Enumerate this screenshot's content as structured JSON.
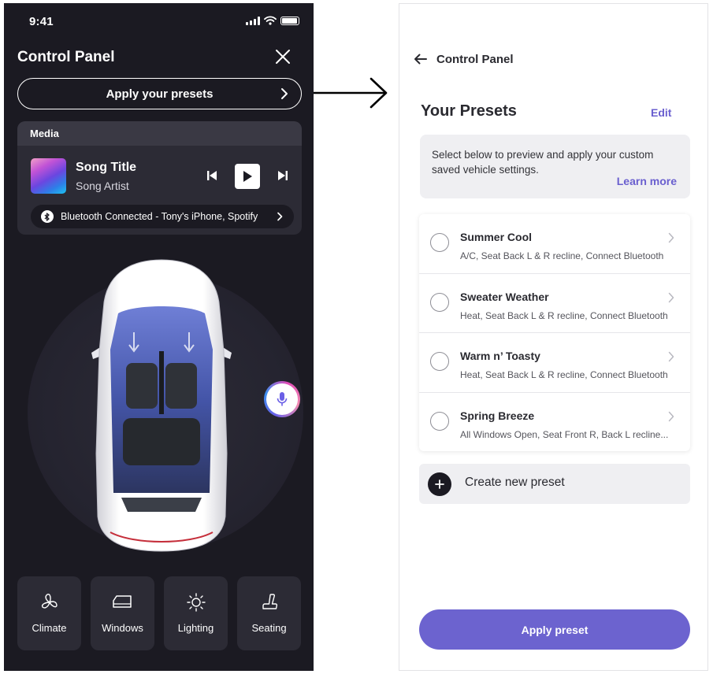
{
  "status_bar": {
    "time": "9:41"
  },
  "control_panel": {
    "title": "Control Panel",
    "presets_button_label": "Apply your presets",
    "media": {
      "section_label": "Media",
      "song_title": "Song Title",
      "song_artist": "Song Artist",
      "bluetooth_status": "Bluetooth Connected - Tony's iPhone, Spotify"
    },
    "tiles": [
      {
        "label": "Climate",
        "icon": "fan-icon"
      },
      {
        "label": "Windows",
        "icon": "window-icon"
      },
      {
        "label": "Lighting",
        "icon": "sun-icon"
      },
      {
        "label": "Seating",
        "icon": "seat-icon"
      }
    ]
  },
  "presets_screen": {
    "back_title": "Control Panel",
    "heading": "Your Presets",
    "edit_label": "Edit",
    "info_text": "Select below to preview and apply your custom saved vehicle settings.",
    "learn_more_label": "Learn more",
    "presets": [
      {
        "name": "Summer Cool",
        "description": "A/C, Seat Back L & R recline, Connect Bluetooth"
      },
      {
        "name": "Sweater Weather",
        "description": "Heat, Seat Back L & R recline, Connect Bluetooth"
      },
      {
        "name": "Warm n’ Toasty",
        "description": "Heat, Seat Back L & R recline, Connect Bluetooth"
      },
      {
        "name": "Spring Breeze",
        "description": "All Windows Open, Seat Front R, Back L recline..."
      }
    ],
    "create_label": "Create new preset",
    "apply_label": "Apply preset"
  },
  "colors": {
    "dark_bg": "#1b1a22",
    "card_bg": "#2c2b35",
    "accent_purple": "#6c63cf",
    "link_purple": "#6a5fcf"
  }
}
